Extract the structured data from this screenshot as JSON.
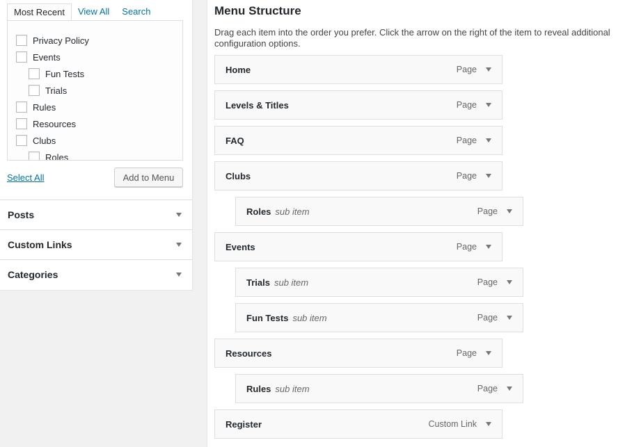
{
  "left": {
    "tabs": [
      "Most Recent",
      "View All",
      "Search"
    ],
    "items": [
      {
        "label": "Privacy Policy",
        "child": false
      },
      {
        "label": "Events",
        "child": false
      },
      {
        "label": "Fun Tests",
        "child": true
      },
      {
        "label": "Trials",
        "child": true
      },
      {
        "label": "Rules",
        "child": false
      },
      {
        "label": "Resources",
        "child": false
      },
      {
        "label": "Clubs",
        "child": false
      },
      {
        "label": "Roles",
        "child": true
      }
    ],
    "select_all": "Select All",
    "add_to_menu": "Add to Menu",
    "sections": [
      "Posts",
      "Custom Links",
      "Categories"
    ]
  },
  "main": {
    "title": "Menu Structure",
    "description": "Drag each item into the order you prefer. Click the arrow on the right of the item to reveal additional configuration options.",
    "items": [
      {
        "title": "Home",
        "sub": "",
        "type": "Page",
        "depth": 0
      },
      {
        "title": "Levels & Titles",
        "sub": "",
        "type": "Page",
        "depth": 0
      },
      {
        "title": "FAQ",
        "sub": "",
        "type": "Page",
        "depth": 0
      },
      {
        "title": "Clubs",
        "sub": "",
        "type": "Page",
        "depth": 0
      },
      {
        "title": "Roles",
        "sub": "sub item",
        "type": "Page",
        "depth": 1
      },
      {
        "title": "Events",
        "sub": "",
        "type": "Page",
        "depth": 0
      },
      {
        "title": "Trials",
        "sub": "sub item",
        "type": "Page",
        "depth": 1
      },
      {
        "title": "Fun Tests",
        "sub": "sub item",
        "type": "Page",
        "depth": 1
      },
      {
        "title": "Resources",
        "sub": "",
        "type": "Page",
        "depth": 0
      },
      {
        "title": "Rules",
        "sub": "sub item",
        "type": "Page",
        "depth": 1
      },
      {
        "title": "Register",
        "sub": "",
        "type": "Custom Link",
        "depth": 0
      }
    ]
  }
}
